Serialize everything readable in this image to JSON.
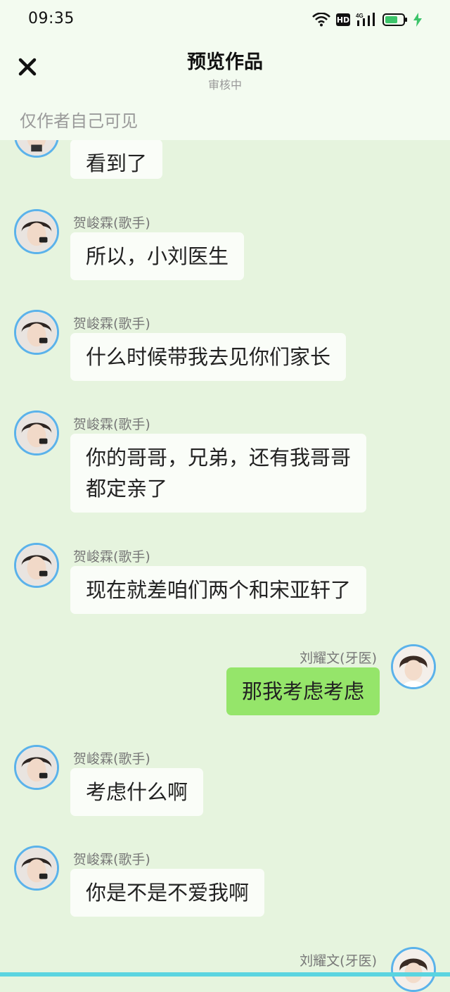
{
  "status_bar": {
    "time": "09:35",
    "hd": "HD",
    "network": "4G"
  },
  "header": {
    "title": "预览作品",
    "subtitle": "审核中",
    "visibility_note": "仅作者自己可见"
  },
  "messages": [
    {
      "side": "left",
      "name": "",
      "text": "看到了"
    },
    {
      "side": "left",
      "name": "贺峻霖(歌手)",
      "text": "所以，小刘医生"
    },
    {
      "side": "left",
      "name": "贺峻霖(歌手)",
      "text": "什么时候带我去见你们家长"
    },
    {
      "side": "left",
      "name": "贺峻霖(歌手)",
      "text": "你的哥哥，兄弟，还有我哥哥\n都定亲了"
    },
    {
      "side": "left",
      "name": "贺峻霖(歌手)",
      "text": "现在就差咱们两个和宋亚轩了"
    },
    {
      "side": "right",
      "name": "刘耀文(牙医)",
      "text": "那我考虑考虑"
    },
    {
      "side": "left",
      "name": "贺峻霖(歌手)",
      "text": "考虑什么啊"
    },
    {
      "side": "left",
      "name": "贺峻霖(歌手)",
      "text": "你是不是不爱我啊"
    },
    {
      "side": "right",
      "name": "刘耀文(牙医)",
      "text": ""
    }
  ],
  "colors": {
    "background": "#e6f4de",
    "left_bubble": "#fafdf8",
    "right_bubble": "#95e56a",
    "avatar_ring": "#5bb2ea"
  },
  "icons": {
    "close": "close-icon",
    "wifi": "wifi-icon",
    "signal": "signal-icon",
    "battery": "battery-icon",
    "charging": "lightning-icon"
  }
}
